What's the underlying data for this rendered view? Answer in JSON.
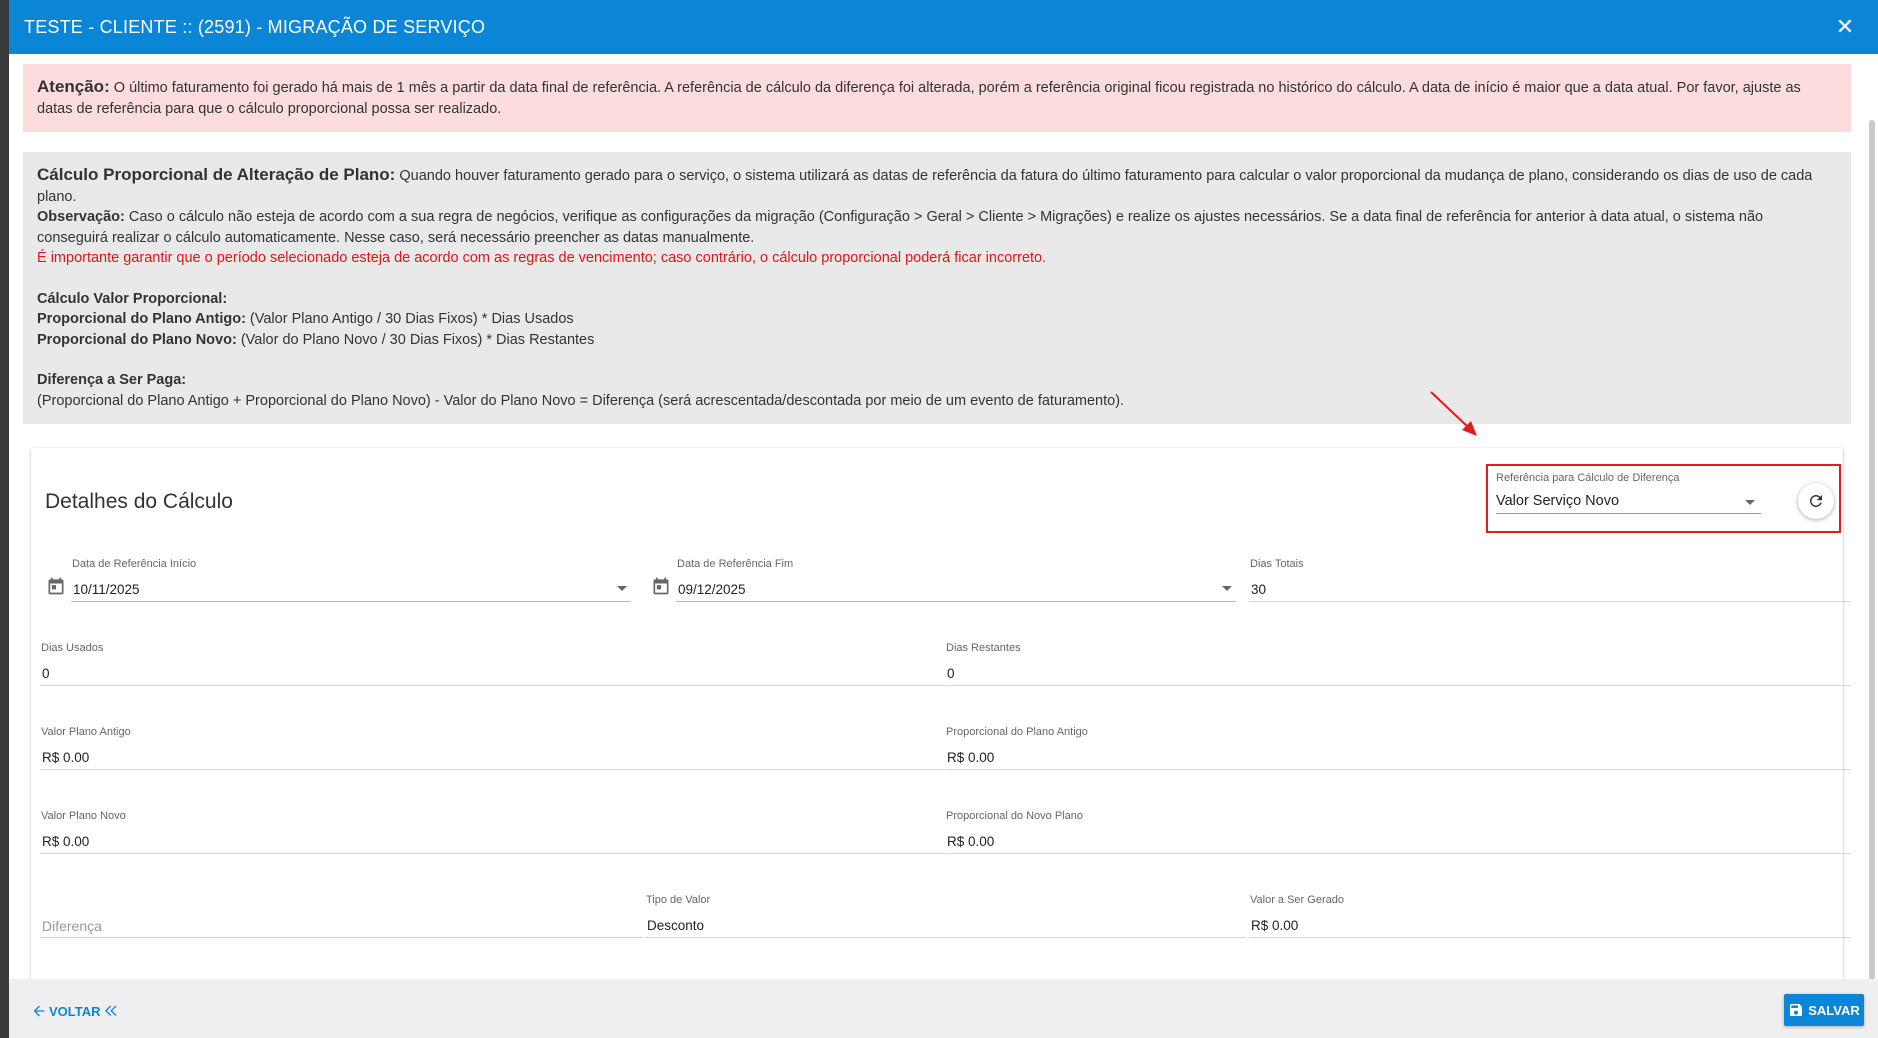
{
  "window": {
    "title": "TESTE - CLIENTE :: (2591) - MIGRAÇÃO DE SERVIÇO",
    "close_glyph": "✕"
  },
  "alert": {
    "heading": "Atenção:",
    "text": " O último faturamento foi gerado há mais de 1 mês a partir da data final de referência. A referência de cálculo da diferença foi alterada, porém a referência original ficou registrada no histórico do cálculo. A data de início é maior que a data atual. Por favor, ajuste as datas de referência para que o cálculo proporcional possa ser realizado."
  },
  "info": {
    "heading": "Cálculo Proporcional de Alteração de Plano:",
    "heading_text": " Quando houver faturamento gerado para o serviço, o sistema utilizará as datas de referência da fatura do último faturamento para calcular o valor proporcional da mudança de plano, considerando os dias de uso de cada plano.",
    "obs_label": "Observação:",
    "obs_text": " Caso o cálculo não esteja de acordo com a sua regra de negócios, verifique as configurações da migração (Configuração > Geral > Cliente > Migrações) e realize os ajustes necessários. Se a data final de referência for anterior à data atual, o sistema não conseguirá realizar o cálculo automaticamente. Nesse caso, será necessário preencher as datas manualmente.",
    "warning": "É importante garantir que o período selecionado esteja de acordo com as regras de vencimento; caso contrário, o cálculo proporcional poderá ficar incorreto.",
    "calc_title": "Cálculo Valor Proporcional:",
    "old_label": "Proporcional do Plano Antigo:",
    "old_formula": " (Valor Plano Antigo / 30 Dias Fixos) * Dias Usados",
    "new_label": "Proporcional do Plano Novo:",
    "new_formula": " (Valor do Plano Novo / 30 Dias Fixos) * Dias Restantes",
    "diff_title": "Diferença a Ser Paga:",
    "diff_formula": "(Proporcional do Plano Antigo + Proporcional do Plano Novo) - Valor do Plano Novo = Diferença (será acrescentada/descontada por meio de um evento de faturamento)."
  },
  "details": {
    "title": "Detalhes do Cálculo",
    "reference": {
      "label": "Referência para Cálculo de Diferença",
      "value": "Valor Serviço Novo"
    },
    "start_date": {
      "label": "Data de Referência Início",
      "value": "10/11/2025"
    },
    "end_date": {
      "label": "Data de Referência Fim",
      "value": "09/12/2025"
    },
    "total_days": {
      "label": "Dias Totais",
      "value": "30"
    },
    "used_days": {
      "label": "Dias Usados",
      "value": "0"
    },
    "remaining_days": {
      "label": "Dias Restantes",
      "value": "0"
    },
    "old_plan_value": {
      "label": "Valor Plano Antigo",
      "value": "R$ 0.00"
    },
    "old_plan_prop": {
      "label": "Proporcional do Plano Antigo",
      "value": "R$ 0.00"
    },
    "new_plan_value": {
      "label": "Valor Plano Novo",
      "value": "R$ 0.00"
    },
    "new_plan_prop": {
      "label": "Proporcional do Novo Plano",
      "value": "R$ 0.00"
    },
    "difference": {
      "placeholder": "Diferença"
    },
    "value_type": {
      "label": "Tipo de Valor",
      "value": "Desconto"
    },
    "value_generated": {
      "label": "Valor a Ser Gerado",
      "value": "R$ 0.00"
    }
  },
  "footer": {
    "back_label": "VOLTAR",
    "save_label": "SALVAR"
  },
  "colors": {
    "primary": "#0b86d6",
    "alert_bg": "#fcdcdc",
    "info_bg": "#e9e9e9",
    "warning_text": "#e01515",
    "highlight_border": "#e41b1b"
  }
}
